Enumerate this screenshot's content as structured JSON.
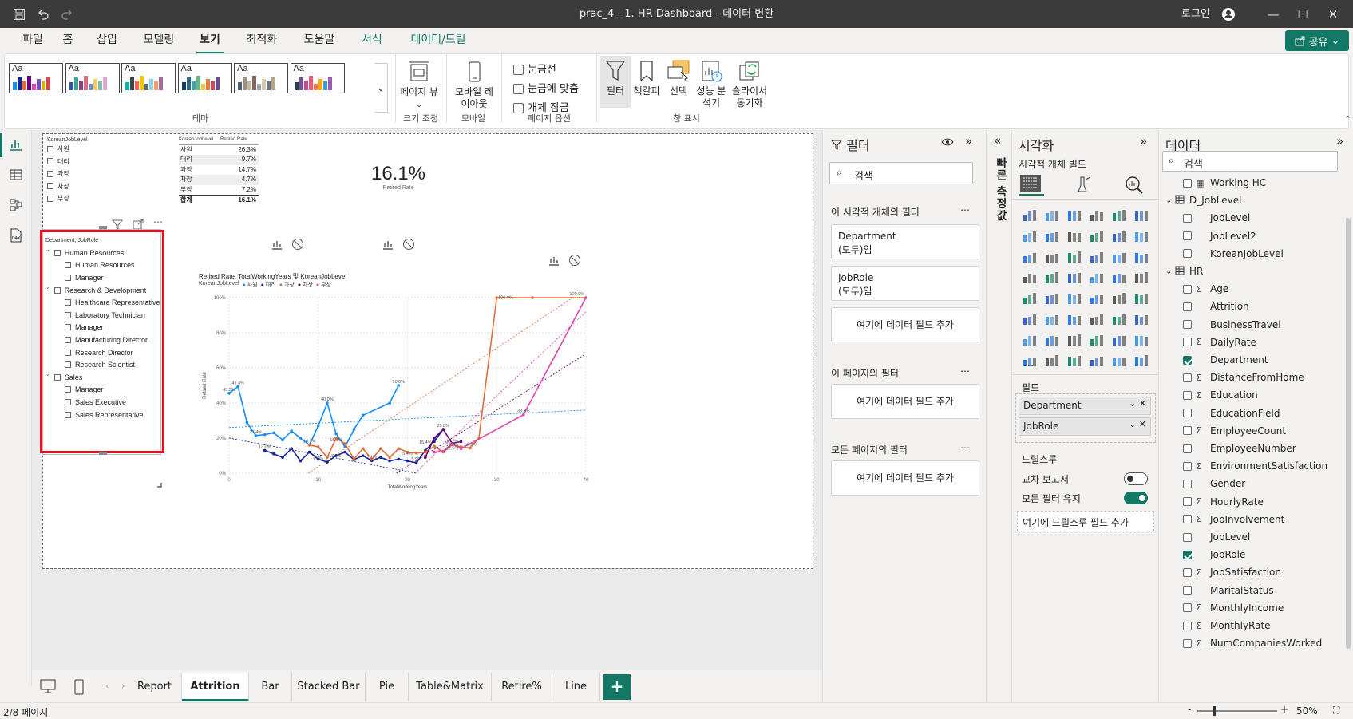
{
  "window": {
    "title": "prac_4 - 1. HR Dashboard - 데이터 변환",
    "login": "로그인"
  },
  "menu": {
    "items": [
      {
        "label": "파일",
        "x": 36,
        "w": 34
      },
      {
        "label": "홈",
        "x": 86,
        "w": 22
      },
      {
        "label": "삽입",
        "x": 131,
        "w": 30
      },
      {
        "label": "모델링",
        "x": 189,
        "w": 44
      },
      {
        "label": "보기",
        "x": 260,
        "w": 30,
        "active": true
      },
      {
        "label": "최적화",
        "x": 318,
        "w": 44
      },
      {
        "label": "도움말",
        "x": 390,
        "w": 44
      },
      {
        "label": "서식",
        "x": 463,
        "w": 30,
        "ctx": true
      },
      {
        "label": "데이터/드릴",
        "x": 523,
        "w": 76,
        "ctx": true
      }
    ],
    "share": "공유"
  },
  "ribbon": {
    "themes_label": "테마",
    "page_view": "페이지 뷰",
    "size_label": "크기 조정",
    "mobile_layout": "모바일 레이아웃",
    "mobile_label": "모바일",
    "gridlines": "눈금선",
    "snap_grid": "눈금에 맞춤",
    "lock_objects": "개체 잠금",
    "page_options_label": "페이지 옵션",
    "filter": "필터",
    "bookmarks": "책갈피",
    "selection": "선택",
    "perf": "성능 분석기",
    "sync": "슬라이서 동기화",
    "panes_label": "창 표시"
  },
  "slicer": {
    "title": "KoreanJobLevel",
    "items": [
      "사원",
      "대리",
      "과장",
      "차장",
      "부장"
    ]
  },
  "table": {
    "headers": [
      "KoreanJobLevel",
      "Retired Rate"
    ],
    "rows": [
      [
        "사원",
        "26.3%"
      ],
      [
        "대리",
        "9.7%"
      ],
      [
        "과장",
        "14.7%"
      ],
      [
        "차장",
        "4.7%"
      ],
      [
        "부장",
        "7.2%"
      ]
    ],
    "total": [
      "합계",
      "16.1%"
    ]
  },
  "card": {
    "value": "16.1%",
    "label": "Retired Rate"
  },
  "tree": {
    "title": "Department, JobRole",
    "groups": [
      {
        "name": "Human Resources",
        "children": [
          "Human Resources",
          "Manager"
        ]
      },
      {
        "name": "Research & Development",
        "children": [
          "Healthcare Representative",
          "Laboratory Technician",
          "Manager",
          "Manufacturing Director",
          "Research Director",
          "Research Scientist"
        ]
      },
      {
        "name": "Sales",
        "children": [
          "Manager",
          "Sales Executive",
          "Sales Representative"
        ]
      }
    ]
  },
  "chart_data": {
    "type": "line",
    "title": "Retired Rate, TotalWorkingYears 및 KoreanJobLevel",
    "xlabel": "TotalWorkingYears",
    "ylabel": "Retired Rate",
    "legend_title": "KoreanJobLevel",
    "xlim": [
      0,
      40
    ],
    "ylim": [
      0,
      100
    ],
    "x_ticks": [
      "0",
      "10",
      "20",
      "30",
      "40"
    ],
    "y_ticks": [
      "0%",
      "20%",
      "40%",
      "60%",
      "80%",
      "100%"
    ],
    "series": [
      {
        "name": "사원",
        "color": "#118dff",
        "x": [
          0,
          1,
          2,
          3,
          4,
          5,
          6,
          7,
          8,
          9,
          10,
          11,
          12,
          13,
          14,
          15,
          18,
          19
        ],
        "y": [
          45.5,
          49.4,
          29,
          21.4,
          22,
          23,
          19,
          24,
          20,
          16.1,
          27,
          40,
          22.5,
          15,
          25,
          33,
          40,
          50
        ]
      },
      {
        "name": "대리",
        "color": "#12239e",
        "x": [
          4,
          5,
          6,
          7,
          8,
          9,
          10,
          11,
          12,
          13,
          14,
          15,
          16,
          17,
          18,
          19,
          20,
          21,
          22,
          23,
          24
        ],
        "y": [
          13,
          11,
          9,
          14,
          7,
          12,
          8,
          6.3,
          10,
          12,
          7.7,
          10,
          7.1,
          9,
          7,
          8,
          7,
          5.9,
          13,
          18,
          25
        ]
      },
      {
        "name": "과장",
        "color": "#e66c37",
        "x": [
          9,
          10,
          11,
          12,
          13,
          14,
          15,
          16,
          17,
          18,
          19,
          20,
          21,
          22,
          23,
          24,
          25,
          26,
          27,
          28,
          30,
          34,
          40
        ],
        "y": [
          16,
          15,
          9,
          20,
          16.8,
          8,
          14,
          8,
          14,
          9,
          14,
          12,
          11.5,
          12,
          15.4,
          12,
          16.2,
          15,
          14.3,
          20,
          100,
          100,
          100
        ]
      },
      {
        "name": "차장",
        "color": "#6b007b",
        "x": [
          22,
          23,
          24,
          25,
          26
        ],
        "y": [
          9,
          20,
          25,
          17,
          18
        ]
      },
      {
        "name": "부장",
        "color": "#e044a7",
        "x": [
          23,
          24,
          25,
          26,
          33,
          40
        ],
        "y": [
          12,
          12.5,
          16.7,
          14,
          33.3,
          100
        ]
      }
    ],
    "data_labels": [
      {
        "x": 1,
        "y": 49.4,
        "t": "49.4%"
      },
      {
        "x": 0,
        "y": 45.5,
        "t": "45.5%"
      },
      {
        "x": 3,
        "y": 21.4,
        "t": "21.4%"
      },
      {
        "x": 4,
        "y": 13,
        "t": "13.0%"
      },
      {
        "x": 9,
        "y": 16.1,
        "t": "16.1%"
      },
      {
        "x": 11,
        "y": 40,
        "t": "40.0%"
      },
      {
        "x": 19,
        "y": 50,
        "t": "50.0%"
      },
      {
        "x": 10,
        "y": 6.3,
        "t": "6.3%"
      },
      {
        "x": 12,
        "y": 7.7,
        "t": "7.7%"
      },
      {
        "x": 12,
        "y": 16.8,
        "t": "16.8%"
      },
      {
        "x": 16,
        "y": 7.1,
        "t": "7.1%"
      },
      {
        "x": 21,
        "y": 5.9,
        "t": "5.9%"
      },
      {
        "x": 20,
        "y": 9,
        "t": "5.4%"
      },
      {
        "x": 22,
        "y": 15.4,
        "t": "15.4%"
      },
      {
        "x": 24,
        "y": 25,
        "t": "25.0%"
      },
      {
        "x": 25,
        "y": 16.2,
        "t": "16.2%"
      },
      {
        "x": 25,
        "y": 12,
        "t": "12.5%"
      },
      {
        "x": 25,
        "y": 14,
        "t": "16.7%"
      },
      {
        "x": 27,
        "y": 14.3,
        "t": "14.3%"
      },
      {
        "x": 33,
        "y": 33.3,
        "t": "33.3%"
      },
      {
        "x": 31,
        "y": 98,
        "t": "100.0%"
      },
      {
        "x": 39,
        "y": 100,
        "t": "100.0%"
      }
    ],
    "trendlines": [
      {
        "color": "#118dff",
        "y0": 26,
        "y1": 36
      },
      {
        "color": "#e66c37",
        "y0": -30,
        "y1": 105
      },
      {
        "color": "#12239e",
        "y0": 20,
        "y1": -18
      },
      {
        "color": "#6b007b",
        "y0": -60,
        "y1": 68
      },
      {
        "color": "#e044a7",
        "y0": -100,
        "y1": 92
      }
    ]
  },
  "filters_pane": {
    "title": "필터",
    "search": "검색",
    "visual_section": "이 시각적 개체의 필터",
    "cards": [
      {
        "name": "Department",
        "val": "(모두)임"
      },
      {
        "name": "JobRole",
        "val": "(모두)임"
      }
    ],
    "add_field": "여기에 데이터 필드 추가",
    "page_section": "이 페이지의 필터",
    "all_section": "모든 페이지의 필터"
  },
  "collapsed_pane": "빠른 측정값",
  "viz_pane": {
    "title": "시각화",
    "subtitle": "시각적 개체 빌드",
    "fields_label": "필드",
    "fields": [
      "Department",
      "JobRole"
    ],
    "drill_label": "드릴스루",
    "cross_report": "교차 보고서",
    "keep_filters": "모든 필터 유지",
    "drill_add": "여기에 드릴스루 필드 추가",
    "more": "..."
  },
  "data_pane": {
    "title": "데이터",
    "search": "검색",
    "rows": [
      {
        "label": "Working HC",
        "indent": 2,
        "kind": "calc"
      },
      {
        "label": "D_JobLevel",
        "indent": 0,
        "kind": "table"
      },
      {
        "label": "JobLevel",
        "indent": 2
      },
      {
        "label": "JobLevel2",
        "indent": 2
      },
      {
        "label": "KoreanJobLevel",
        "indent": 2
      },
      {
        "label": "HR",
        "indent": 0,
        "kind": "table"
      },
      {
        "label": "Age",
        "indent": 2,
        "sigma": true
      },
      {
        "label": "Attrition",
        "indent": 2
      },
      {
        "label": "BusinessTravel",
        "indent": 2
      },
      {
        "label": "DailyRate",
        "indent": 2,
        "sigma": true
      },
      {
        "label": "Department",
        "indent": 2,
        "checked": true
      },
      {
        "label": "DistanceFromHome",
        "indent": 2,
        "sigma": true
      },
      {
        "label": "Education",
        "indent": 2,
        "sigma": true
      },
      {
        "label": "EducationField",
        "indent": 2
      },
      {
        "label": "EmployeeCount",
        "indent": 2,
        "sigma": true
      },
      {
        "label": "EmployeeNumber",
        "indent": 2
      },
      {
        "label": "EnvironmentSatisfaction",
        "indent": 2,
        "sigma": true
      },
      {
        "label": "Gender",
        "indent": 2
      },
      {
        "label": "HourlyRate",
        "indent": 2,
        "sigma": true
      },
      {
        "label": "JobInvolvement",
        "indent": 2,
        "sigma": true
      },
      {
        "label": "JobLevel",
        "indent": 2
      },
      {
        "label": "JobRole",
        "indent": 2,
        "checked": true
      },
      {
        "label": "JobSatisfaction",
        "indent": 2,
        "sigma": true
      },
      {
        "label": "MaritalStatus",
        "indent": 2
      },
      {
        "label": "MonthlyIncome",
        "indent": 2,
        "sigma": true
      },
      {
        "label": "MonthlyRate",
        "indent": 2,
        "sigma": true
      },
      {
        "label": "NumCompaniesWorked",
        "indent": 2,
        "sigma": true
      }
    ]
  },
  "pages": {
    "tabs": [
      "Report",
      "Attrition",
      "Bar",
      "Stacked Bar",
      "Pie",
      "Table&Matrix",
      "Retire%",
      "Line"
    ],
    "active": 1,
    "add": "+"
  },
  "status": {
    "page": "2/8 페이지",
    "zoom": "50%"
  }
}
